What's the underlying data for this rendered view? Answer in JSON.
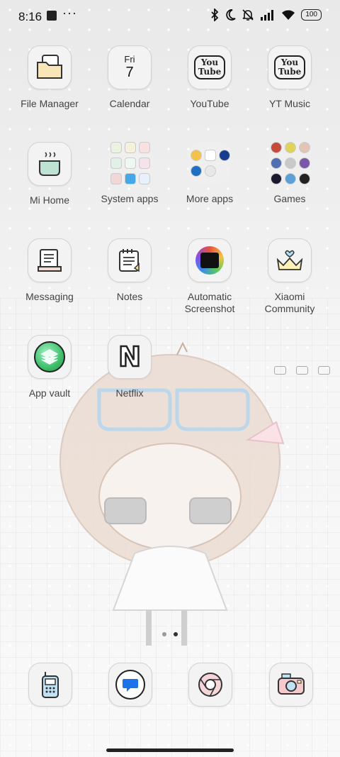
{
  "status_bar": {
    "time": "8:16",
    "more_glyph": "···",
    "battery": "100",
    "icons": [
      "bluetooth-icon",
      "moon-icon",
      "bell-off-icon",
      "signal-icon",
      "wifi-icon"
    ]
  },
  "home": {
    "rows": [
      [
        {
          "label": "File Manager",
          "icon": "folder-doc-icon"
        },
        {
          "label": "Calendar",
          "icon": "calendar-icon",
          "day_name": "Fri",
          "day_num": "7"
        },
        {
          "label": "YouTube",
          "icon": "youtube-icon",
          "badge_top": "You",
          "badge_bottom": "Tube"
        },
        {
          "label": "YT Music",
          "icon": "yt-music-icon",
          "badge_top": "You",
          "badge_bottom": "Tube"
        }
      ],
      [
        {
          "label": "Mi Home",
          "icon": "teapot-icon"
        },
        {
          "label": "System apps",
          "icon": "folder-icon"
        },
        {
          "label": "More apps",
          "icon": "folder-icon"
        },
        {
          "label": "Games",
          "icon": "folder-icon"
        }
      ],
      [
        {
          "label": "Messaging",
          "icon": "message-icon"
        },
        {
          "label": "Notes",
          "icon": "notes-icon"
        },
        {
          "label_line1": "Automatic",
          "label_line2": "Screenshot",
          "icon": "screenshot-icon"
        },
        {
          "label_line1": "Xiaomi",
          "label_line2": "Community",
          "icon": "crown-icon"
        }
      ],
      [
        {
          "label": "App vault",
          "icon": "app-vault-icon"
        },
        {
          "label": "Netflix",
          "icon": "netflix-icon",
          "letter": "N"
        }
      ]
    ]
  },
  "dock": [
    {
      "name": "phone",
      "icon": "phone-icon"
    },
    {
      "name": "messages",
      "icon": "chat-bubble-icon"
    },
    {
      "name": "chrome",
      "icon": "chrome-icon"
    },
    {
      "name": "camera",
      "icon": "camera-icon"
    }
  ],
  "colors": {
    "label": "#444444",
    "tile_border": "#d2d2d2",
    "vault_green": "#3fbf6a"
  }
}
